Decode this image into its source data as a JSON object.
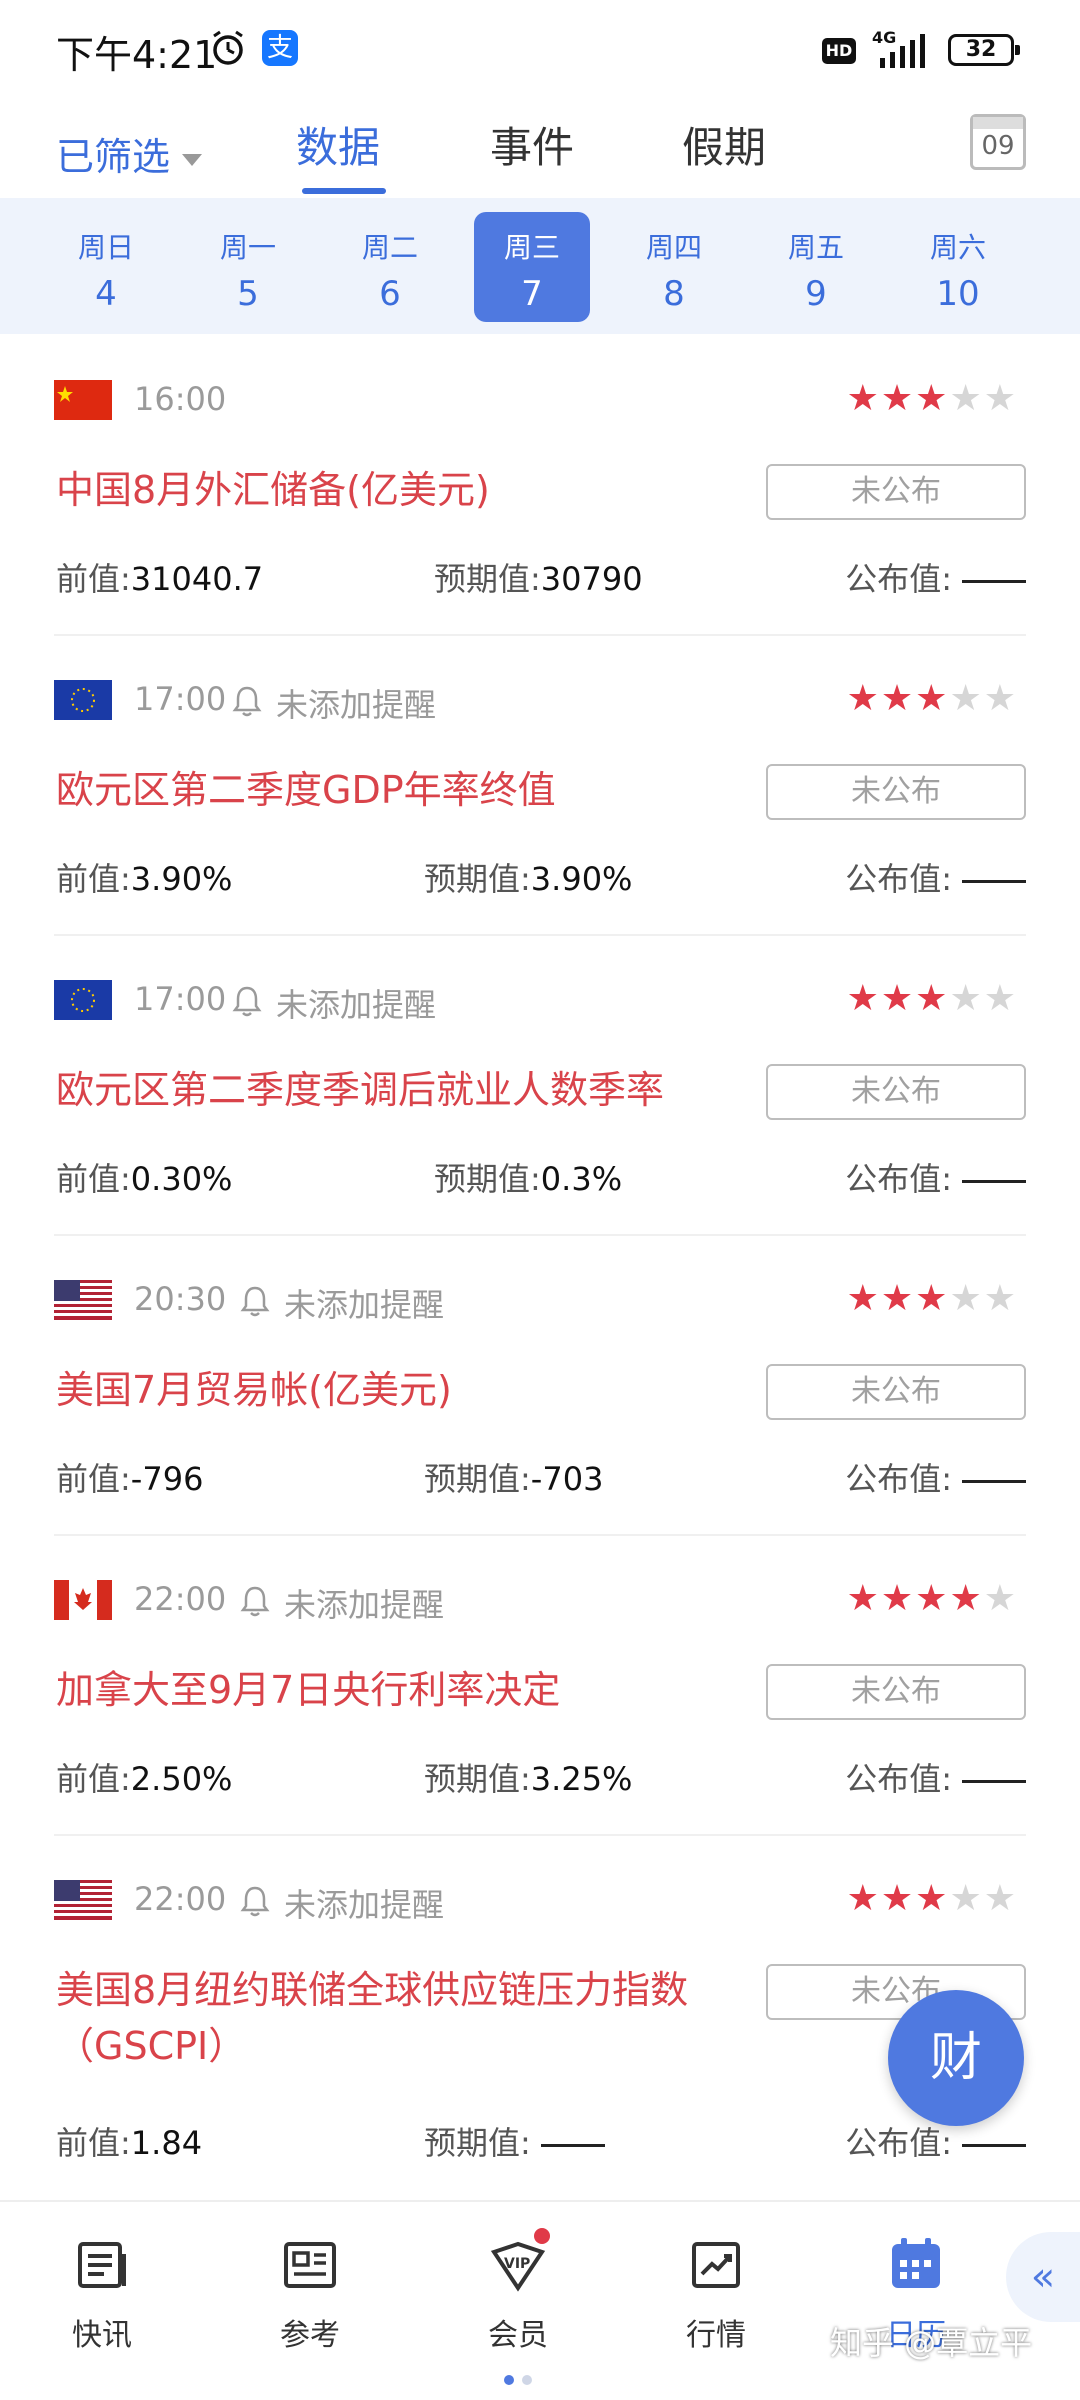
{
  "status_bar": {
    "time": "下午4:21",
    "network": "4G",
    "battery": "32",
    "hd": "HD",
    "alipay": "支"
  },
  "topnav": {
    "filter_label": "已筛选",
    "tabs": [
      {
        "label": "数据",
        "active": true
      },
      {
        "label": "事件",
        "active": false
      },
      {
        "label": "假期",
        "active": false
      }
    ],
    "calendar_day": "09"
  },
  "week": [
    {
      "weekday": "周日",
      "date": "4"
    },
    {
      "weekday": "周一",
      "date": "5"
    },
    {
      "weekday": "周二",
      "date": "6"
    },
    {
      "weekday": "周三",
      "date": "7",
      "selected": true
    },
    {
      "weekday": "周四",
      "date": "8"
    },
    {
      "weekday": "周五",
      "date": "9"
    },
    {
      "weekday": "周六",
      "date": "10"
    }
  ],
  "events": [
    {
      "flag": "china-flag",
      "time": "16:00",
      "remind": "",
      "stars": 3,
      "title": "中国8月外汇储备(亿美元)",
      "status": "未公布",
      "prev_label": "前值:",
      "prev": "31040.7",
      "forecast_label": "预期值:",
      "forecast": "30790",
      "actual_label": "公布值:"
    },
    {
      "flag": "eu-flag",
      "time": "17:00",
      "remind": "未添加提醒",
      "stars": 3,
      "title": "欧元区第二季度GDP年率终值",
      "status": "未公布",
      "prev_label": "前值:",
      "prev": "3.90%",
      "forecast_label": "预期值:",
      "forecast": "3.90%",
      "actual_label": "公布值:"
    },
    {
      "flag": "eu-flag",
      "time": "17:00",
      "remind": "未添加提醒",
      "stars": 3,
      "title": "欧元区第二季度季调后就业人数季率",
      "status": "未公布",
      "prev_label": "前值:",
      "prev": "0.30%",
      "forecast_label": "预期值:",
      "forecast": "0.3%",
      "actual_label": "公布值:"
    },
    {
      "flag": "us-flag",
      "time": "20:30",
      "remind": "未添加提醒",
      "stars": 3,
      "title": "美国7月贸易帐(亿美元)",
      "status": "未公布",
      "prev_label": "前值:",
      "prev": "-796",
      "forecast_label": "预期值:",
      "forecast": "-703",
      "actual_label": "公布值:"
    },
    {
      "flag": "canada-flag",
      "time": "22:00",
      "remind": "未添加提醒",
      "stars": 4,
      "title": "加拿大至9月7日央行利率决定",
      "status": "未公布",
      "prev_label": "前值:",
      "prev": "2.50%",
      "forecast_label": "预期值:",
      "forecast": "3.25%",
      "actual_label": "公布值:"
    },
    {
      "flag": "us-flag",
      "time": "22:00",
      "remind": "未添加提醒",
      "stars": 3,
      "title": "美国8月纽约联储全球供应链压力指数（GSCPI）",
      "status": "未公布",
      "prev_label": "前值:",
      "prev": "1.84",
      "forecast_label": "预期值:",
      "forecast": "",
      "actual_label": "公布值:"
    }
  ],
  "fab_label": "财",
  "bottom_nav": [
    {
      "label": "快讯",
      "icon": "news-flash-icon"
    },
    {
      "label": "参考",
      "icon": "reference-icon"
    },
    {
      "label": "会员",
      "icon": "vip-icon"
    },
    {
      "label": "行情",
      "icon": "market-chart-icon"
    },
    {
      "label": "日历",
      "icon": "calendar-icon",
      "active": true
    }
  ],
  "watermark": "知乎 @覃立平",
  "colors": {
    "accent": "#4f79e0",
    "title_red": "#d9434a",
    "star_red": "#e03a48",
    "week_bg": "#eef3fc"
  }
}
